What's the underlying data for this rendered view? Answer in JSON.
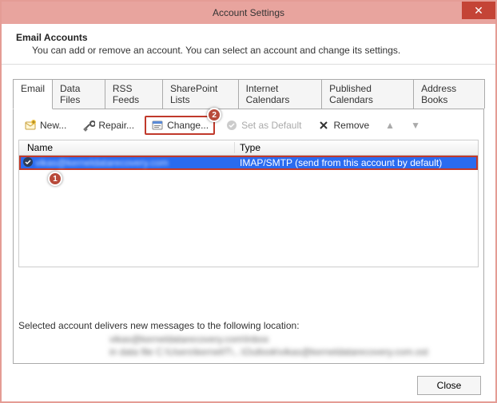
{
  "window": {
    "title": "Account Settings"
  },
  "header": {
    "title": "Email Accounts",
    "subtitle": "You can add or remove an account. You can select an account and change its settings."
  },
  "tabs": [
    {
      "label": "Email",
      "active": true
    },
    {
      "label": "Data Files"
    },
    {
      "label": "RSS Feeds"
    },
    {
      "label": "SharePoint Lists"
    },
    {
      "label": "Internet Calendars"
    },
    {
      "label": "Published Calendars"
    },
    {
      "label": "Address Books"
    }
  ],
  "toolbar": {
    "new_label": "New...",
    "repair_label": "Repair...",
    "change_label": "Change...",
    "default_label": "Set as Default",
    "remove_label": "Remove"
  },
  "list": {
    "columns": {
      "name": "Name",
      "type": "Type"
    },
    "rows": [
      {
        "name": "vikas@kerneldatarecovery.com",
        "type": "IMAP/SMTP (send from this account by default)",
        "selected": true
      }
    ]
  },
  "annotations": {
    "row_badge": "1",
    "change_badge": "2"
  },
  "delivery": {
    "label": "Selected account delivers new messages to the following location:",
    "line1": "vikas@kerneldatarecovery.com\\Inbox",
    "line2": "in data file C:\\Users\\kernelIT\\...\\Outlook\\vikas@kerneldatarecovery.com.ost"
  },
  "footer": {
    "close_label": "Close"
  }
}
